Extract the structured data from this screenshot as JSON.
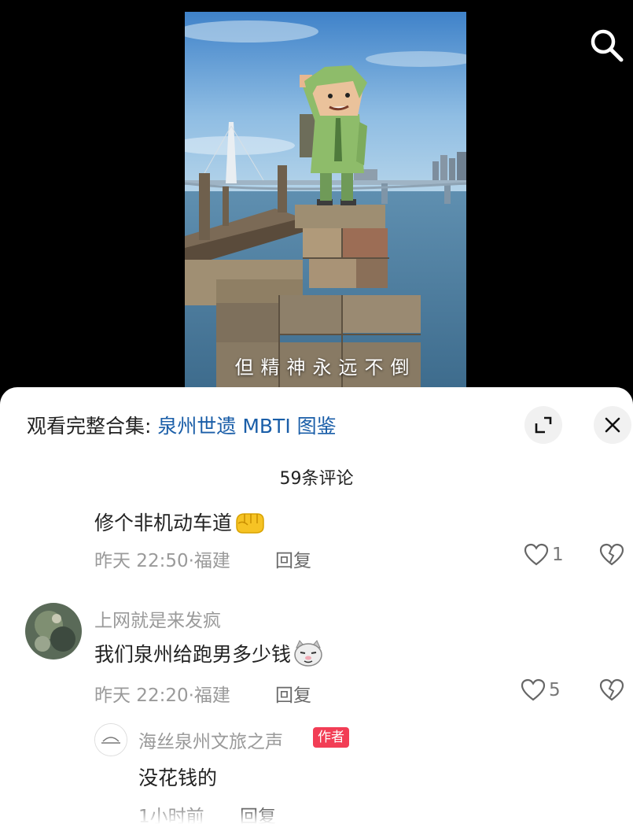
{
  "video": {
    "subtitle": "但精神永远不倒"
  },
  "sheet": {
    "collection_prefix": "观看完整合集: ",
    "collection_name": "泉州世遗 MBTI 图鉴",
    "comment_count": "59条评论"
  },
  "comments": [
    {
      "text": "修个非机动车道",
      "emoji": "fist-emoji",
      "time": "昨天 22:50",
      "location": "福建",
      "reply_label": "回复",
      "likes": "1"
    },
    {
      "username": "上网就是来发疯",
      "text": "我们泉州给跑男多少钱",
      "emoji": "cat-emoji",
      "time": "昨天 22:20",
      "location": "福建",
      "reply_label": "回复",
      "likes": "5"
    }
  ],
  "reply": {
    "username": "海丝泉州文旅之声",
    "badge": "作者",
    "text": "没花钱的",
    "time": "1小时前",
    "reply_label": "回复"
  },
  "colors": {
    "link_blue": "#1a5ea8",
    "badge_red": "#f23d55",
    "meta_gray": "#9a9a9a"
  }
}
